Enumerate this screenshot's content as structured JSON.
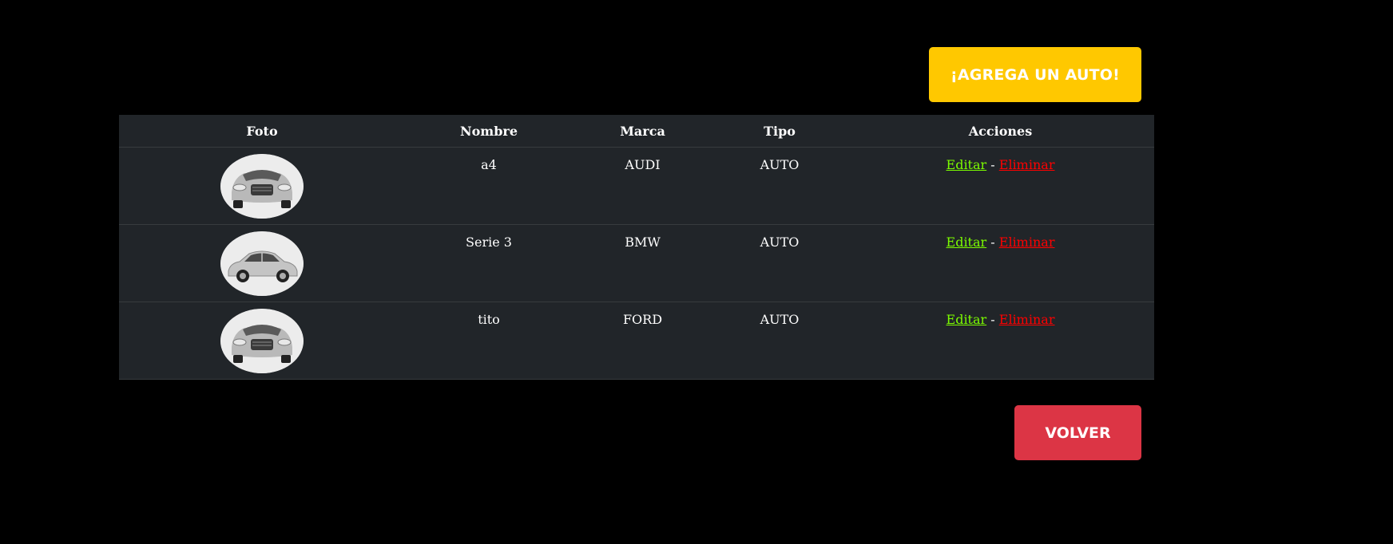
{
  "toolbar": {
    "add_label": "¡AGREGA UN AUTO!",
    "back_label": "VOLVER"
  },
  "table": {
    "headers": [
      "Foto",
      "Nombre",
      "Marca",
      "Tipo",
      "Acciones"
    ],
    "rows": [
      {
        "photo": "car-front-icon",
        "nombre": "a4",
        "marca": "AUDI",
        "tipo": "AUTO",
        "edit": "Editar",
        "sep": "-",
        "delete": "Eliminar"
      },
      {
        "photo": "car-side-icon",
        "nombre": "Serie 3",
        "marca": "BMW",
        "tipo": "AUTO",
        "edit": "Editar",
        "sep": "-",
        "delete": "Eliminar"
      },
      {
        "photo": "car-front-icon",
        "nombre": "tito",
        "marca": "FORD",
        "tipo": "AUTO",
        "edit": "Editar",
        "sep": "-",
        "delete": "Eliminar"
      }
    ]
  },
  "colors": {
    "add_button": "#ffc800",
    "back_button": "#dc3545",
    "table_bg": "#212529",
    "edit_link": "#7cfc00",
    "delete_link": "#ff0000"
  }
}
